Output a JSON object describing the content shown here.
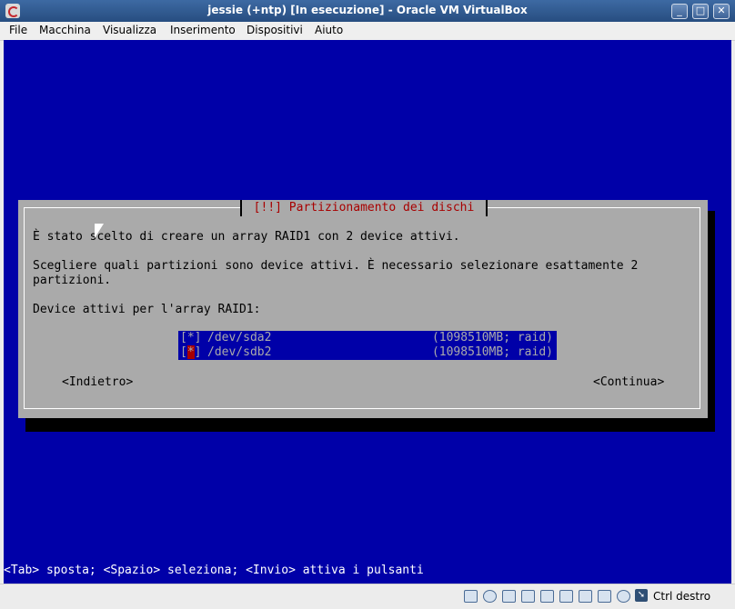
{
  "window": {
    "title": "jessie (+ntp) [In esecuzione] - Oracle VM VirtualBox",
    "minimize": "_",
    "maximize": "□",
    "close": "✕"
  },
  "menu": [
    "File",
    "Macchina",
    "Visualizza",
    "Inserimento",
    "Dispositivi",
    "Aiuto"
  ],
  "dialog": {
    "title": "[!!] Partizionamento dei dischi",
    "text1": "È stato scelto di creare un array RAID1 con 2 device attivi.",
    "text2": "Scegliere quali partizioni sono device attivi. È necessario selezionare esattamente 2 partizioni.",
    "text3": "Device attivi per l'array RAID1:",
    "items": [
      {
        "checkbox": "[*]",
        "device": "/dev/sda2",
        "size": "(1098510MB; raid)"
      },
      {
        "checkbox_open": "[",
        "checkbox_mark": "*",
        "checkbox_close": "]",
        "device": "/dev/sdb2",
        "size": "(1098510MB; raid)"
      }
    ],
    "back_button": "<Indietro>",
    "continue_button": "<Continua>"
  },
  "hint": "<Tab> sposta; <Spazio> seleziona; <Invio> attiva i pulsanti",
  "status": {
    "icons": [
      "hard-disk-icon",
      "optical-drive-icon",
      "audio-icon",
      "usb-icon",
      "shared-folders-icon",
      "display-icon",
      "network-icon",
      "video-capture-icon",
      "cpu-icon",
      "mouse-integration-icon"
    ],
    "host_key_label": "Ctrl destro"
  },
  "colors": {
    "guest_background": "#0000a8",
    "dialog_background": "#aaaaaa",
    "title_red": "#a80000"
  }
}
